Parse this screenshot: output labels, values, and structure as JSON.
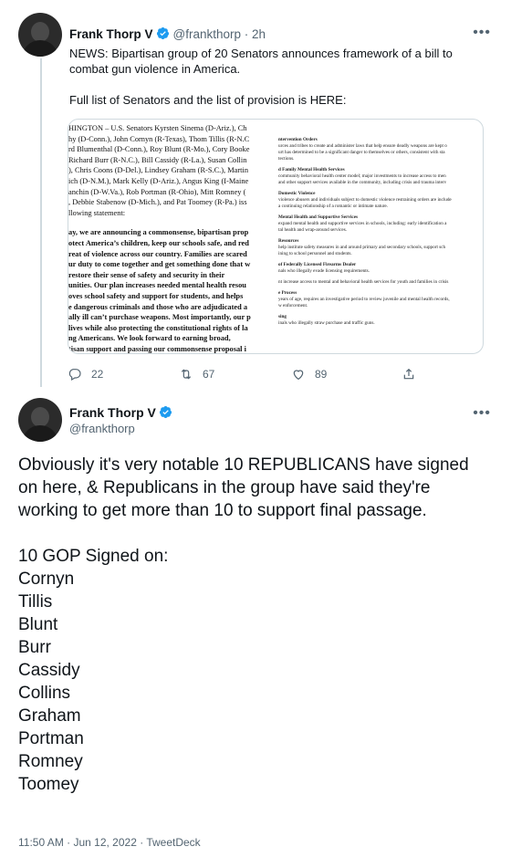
{
  "quoted_tweet": {
    "author_name": "Frank Thorp V",
    "handle": "@frankthorp",
    "time": "2h",
    "meta": "@frankthorp · 2h",
    "text_1": "NEWS: Bipartisan group of 20 Senators announces framework of a bill to combat gun violence in America.",
    "text_2": "Full list of Senators and the list of provision is HERE:",
    "doc_left_lines": [
      "HINGTON – U.S. Senators Kyrsten Sinema (D-Ariz.), Ch",
      "hy (D-Conn.), John Cornyn (R-Texas), Thom Tillis (R-N.C",
      "rd Blumenthal (D-Conn.), Roy Blunt (R-Mo.), Cory Booke",
      "Richard Burr (R-N.C.), Bill Cassidy (R-La.), Susan Collin",
      "), Chris Coons (D-Del.), Lindsey Graham (R-S.C.), Martin",
      "ich (D-N.M.), Mark Kelly (D-Ariz.), Angus King (I-Maine",
      "anchin (D-W.Va.), Rob Portman (R-Ohio), Mitt Romney (",
      ", Debbie Stabenow (D-Mich.), and Pat Toomey (R-Pa.) iss",
      "llowing statement:"
    ],
    "doc_left_bold_lines": [
      "ay, we are announcing a commonsense, bipartisan prop",
      "otect America’s children, keep our schools safe, and red",
      "reat of violence across our country. Families are scared",
      "ur duty to come together and get something done that w",
      "restore their sense of safety and security in their",
      "unities. Our plan increases needed mental health resou",
      "oves school safety and support for students, and helps",
      "e dangerous criminals and those who are adjudicated a",
      "ally ill can’t purchase weapons. Most importantly, our p",
      "lives while also protecting the constitutional rights of la",
      "ng Americans. We look forward to earning broad,",
      "tisan support and passing our commonsense proposal i"
    ],
    "doc_right_sections": [
      {
        "heading": "ntervention Orders",
        "lines": [
          "urces and tribes to create and administer laws that help ensure deadly weapons are kept o",
          "urt has determined to be a significant danger to themselves or others, consistent with sta",
          "tections."
        ]
      },
      {
        "heading": "d Family Mental Health Services",
        "lines": [
          "community behavioral health center model; major investments to increase access to men",
          "and other support services available in the community, including crisis and trauma interv"
        ]
      },
      {
        "heading": "Domestic Violence",
        "lines": [
          "violence abusers and individuals subject to domestic violence restraining orders are include",
          "a continuing relationship of a romantic or intimate nature."
        ]
      },
      {
        "heading": "Mental Health and Supportive Services",
        "lines": [
          "expand mental health and supportive services in schools, including: early identification a",
          "tal health and wrap-around services."
        ]
      },
      {
        "heading": "Resources",
        "lines": [
          "help institute safety measures in and around primary and secondary schools, support sch",
          "ining to school personnel and students."
        ]
      },
      {
        "heading": "of Federally Licensed Firearms Dealer",
        "lines": [
          "nals who illegally evade licensing requirements."
        ]
      },
      {
        "heading": "",
        "lines": [
          "nt increase access to mental and behavioral health services for youth and families in crisis"
        ]
      },
      {
        "heading": "e Process",
        "lines": [
          "years of age, requires an investigative period to review juvenile and mental health records,",
          "w enforcement."
        ]
      },
      {
        "heading": "sing",
        "lines": [
          "inals who illegally straw purchase and traffic guns."
        ]
      }
    ],
    "actions": {
      "replies": "22",
      "retweets": "67",
      "likes": "89"
    }
  },
  "main_tweet": {
    "author_name": "Frank Thorp V",
    "handle": "@frankthorp",
    "text": "Obviously it's very notable 10 REPUBLICANS have signed on here, & Republicans in the group have said they're working to get more than 10 to support final passage.",
    "list_heading": "10 GOP Signed on:",
    "list": [
      "Cornyn",
      "Tillis",
      "Blunt",
      "Burr",
      "Cassidy",
      "Collins",
      "Graham",
      "Portman",
      "Romney",
      "Toomey"
    ],
    "timestamp": "11:50 AM · Jun 12, 2022 · TweetDeck"
  },
  "colors": {
    "verified_blue": "#1d9bf0",
    "secondary_text": "#536471",
    "border": "#cfd9de"
  },
  "icons": {
    "more": "more-horizontal-icon",
    "reply": "reply-icon",
    "retweet": "retweet-icon",
    "like": "heart-icon",
    "share": "share-icon",
    "verified": "verified-badge-icon"
  }
}
